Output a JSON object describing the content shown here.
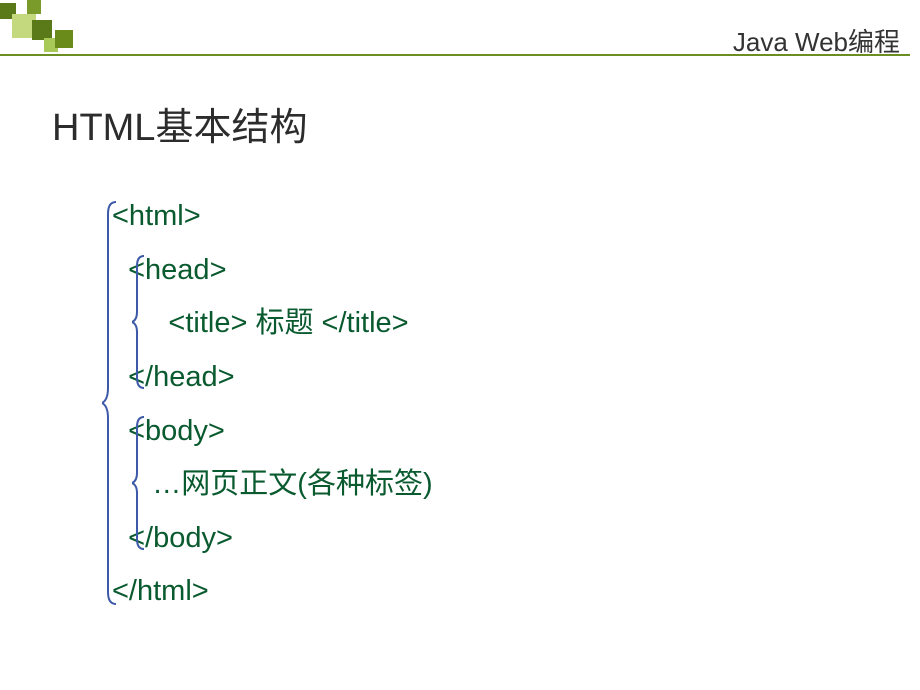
{
  "header": {
    "text": "Java Web编程"
  },
  "title": "HTML基本结构",
  "code": {
    "line1": "<html>",
    "line2": "  <head>",
    "line3": "       <title> 标题 </title>",
    "line4": "  </head>",
    "line5": "  <body>",
    "line6": "     …网页正文(各种标签)",
    "line7": "  </body>",
    "line8": "</html>"
  }
}
